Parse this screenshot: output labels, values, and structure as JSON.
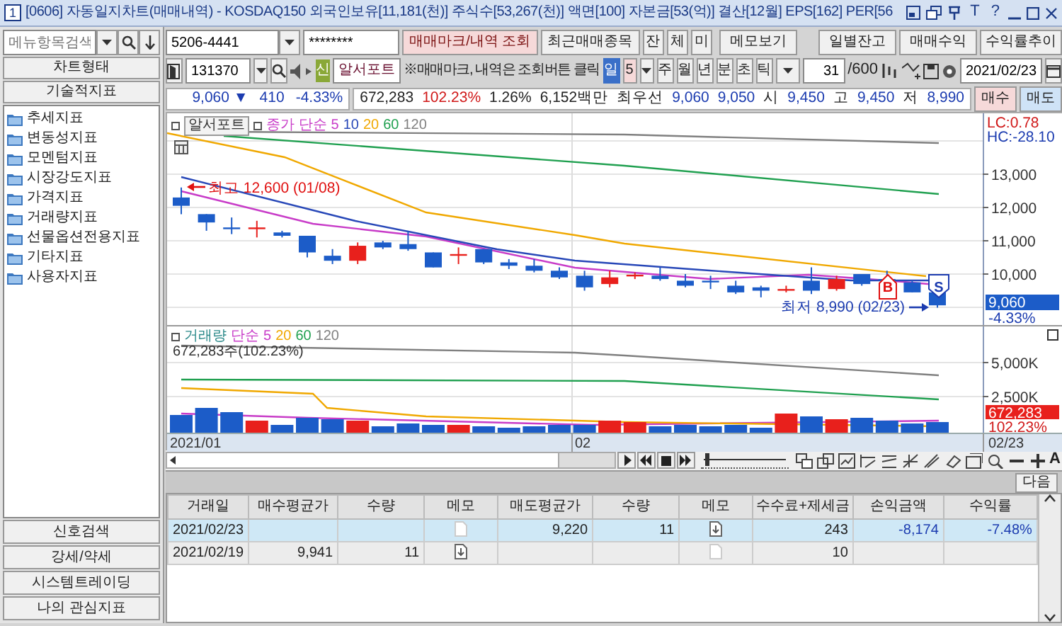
{
  "window": {
    "badge": "1",
    "title": "[0606] 자동일지차트(매매내역) - KOSDAQ150 외국인보유[11,181(천)] 주식수[53,267(천)] 액면[100] 자본금[53(억)] 결산[12월] EPS[162] PER[56",
    "tools": [
      "T",
      "?"
    ]
  },
  "sidebar": {
    "search": {
      "placeholder": "메뉴항목검색"
    },
    "headers": [
      "차트형태",
      "기술적지표"
    ],
    "tree": [
      {
        "label": "추세지표"
      },
      {
        "label": "변동성지표"
      },
      {
        "label": "모멘텀지표"
      },
      {
        "label": "시장강도지표"
      },
      {
        "label": "가격지표"
      },
      {
        "label": "거래량지표"
      },
      {
        "label": "선물옵션전용지표"
      },
      {
        "label": "기타지표"
      },
      {
        "label": "사용자지표"
      }
    ],
    "bottom_buttons": [
      "신호검색",
      "강세/약세",
      "시스템트레이딩",
      "나의 관심지표"
    ]
  },
  "toolbar": {
    "account": "5206-4441",
    "password": "********",
    "buttons": [
      {
        "label": "매매마크/내역 조회",
        "kind": "accent"
      },
      {
        "label": "최근매매종목",
        "kind": "plain"
      },
      {
        "label": "잔",
        "kind": "small"
      },
      {
        "label": "체",
        "kind": "small"
      },
      {
        "label": "미",
        "kind": "small"
      },
      {
        "label": "메모보기",
        "kind": "plain"
      }
    ],
    "report_buttons": [
      "일별잔고",
      "매매수익",
      "수익률추이"
    ]
  },
  "symbol_bar": {
    "code": "131370",
    "badge": "신",
    "name": "알서포트",
    "hint": "※매매마크, 내역은 조회버튼 클릭",
    "periods": [
      {
        "label": "일",
        "selected": true
      },
      {
        "label": "주",
        "selected": false
      },
      {
        "label": "월",
        "selected": false
      },
      {
        "label": "년",
        "selected": false
      },
      {
        "label": "분",
        "selected": false
      },
      {
        "label": "초",
        "selected": false
      },
      {
        "label": "틱",
        "selected": false
      }
    ],
    "interval": "5",
    "count": "31",
    "max": "/600",
    "date": "2021/02/23"
  },
  "quote": [
    {
      "text": "9,060 ▼",
      "color": "#1c3cb0"
    },
    {
      "text": "410",
      "color": "#1c3cb0"
    },
    {
      "text": "-4.33%",
      "color": "#1c3cb0"
    }
  ],
  "market": [
    {
      "text": "672,283",
      "color": "#222222"
    },
    {
      "text": "102.23%",
      "color": "#d01818"
    },
    {
      "text": "1.26%",
      "color": "#222222"
    },
    {
      "text": "6,152백만",
      "color": "#222222"
    },
    {
      "text": "최우선",
      "color": "#222222"
    },
    {
      "text": "9,060",
      "color": "#1c3cb0"
    },
    {
      "text": "9,050",
      "color": "#1c3cb0"
    },
    {
      "text": "시",
      "color": "#222222"
    },
    {
      "text": "9,450",
      "color": "#1c3cb0"
    },
    {
      "text": "고",
      "color": "#222222"
    },
    {
      "text": "9,450",
      "color": "#1c3cb0"
    },
    {
      "text": "저",
      "color": "#222222"
    },
    {
      "text": "8,990",
      "color": "#1c3cb0"
    }
  ],
  "trade_buttons": [
    {
      "label": "매수",
      "kind": "buy"
    },
    {
      "label": "매도",
      "kind": "sell"
    }
  ],
  "chart": {
    "name": "알서포트",
    "ma_label": "종가 단순",
    "ma": [
      {
        "label": "5",
        "color": "#c83cc8"
      },
      {
        "label": "10",
        "color": "#2848b8"
      },
      {
        "label": "20",
        "color": "#f0a800"
      },
      {
        "label": "60",
        "color": "#20a050"
      },
      {
        "label": "120",
        "color": "#808080"
      }
    ],
    "high_label": "최고 12,600 (01/08)",
    "low_label": "최저 8,990 (02/23)",
    "markers": [
      {
        "label": "B",
        "kind": "buy"
      },
      {
        "label": "S",
        "kind": "sell"
      }
    ],
    "lc": "LC:0.78",
    "hc": "HC:-28.10",
    "ticks": [
      "13,000",
      "12,000",
      "11,000",
      "10,000"
    ],
    "last_price": "9,060",
    "last_change": "-4.33%"
  },
  "volume": {
    "name": "거래량",
    "ma_label": "단순",
    "ma": [
      {
        "label": "5",
        "color": "#c83cc8"
      },
      {
        "label": "20",
        "color": "#f0a800"
      },
      {
        "label": "60",
        "color": "#20a050"
      },
      {
        "label": "120",
        "color": "#808080"
      }
    ],
    "reading": "672,283주(102.23%)",
    "ticks": [
      "5,000K",
      "2,500K"
    ],
    "last": "672,283",
    "last_pct": "102.23%"
  },
  "x_axis": {
    "labels": [
      "2021/01",
      "02"
    ],
    "last": "02/23"
  },
  "zoom_slider": {
    "level": 0.05
  },
  "font_button": "A",
  "next_button": "다음",
  "table": {
    "columns": [
      "거래일",
      "매수평균가",
      "수량",
      "메모",
      "매도평균가",
      "수량",
      "메모",
      "수수료+제세금",
      "손익금액",
      "수익률"
    ],
    "rows": [
      {
        "selected": true,
        "date": "2021/02/23",
        "buy_memo_note": false,
        "sell_avg": "9,220",
        "sell_qty": "11",
        "sell_memo_note": true,
        "fee": "243",
        "pnl": "-8,174",
        "rate": "-7.48%"
      },
      {
        "selected": false,
        "date": "2021/02/19",
        "buy_avg": "9,941",
        "buy_qty": "11",
        "buy_memo_note": true,
        "sell_memo_note": false,
        "fee": "10"
      }
    ]
  }
}
